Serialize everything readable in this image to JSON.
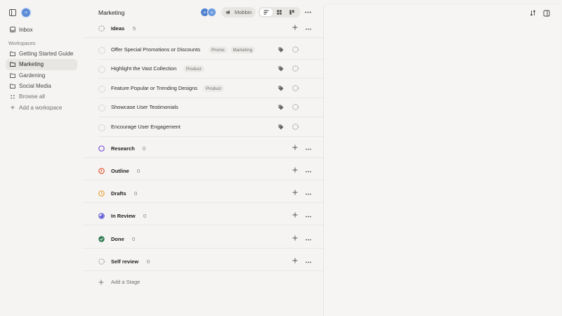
{
  "sidebar": {
    "avatar_initials": "JE",
    "inbox_label": "Inbox",
    "section_label": "Workspaces",
    "items": [
      {
        "label": "Getting Started Guide",
        "icon": "folder-icon",
        "active": false
      },
      {
        "label": "Marketing",
        "icon": "folder-icon",
        "active": true
      },
      {
        "label": "Gardening",
        "icon": "folder-icon",
        "active": false
      },
      {
        "label": "Social Media",
        "icon": "folder-icon",
        "active": false
      },
      {
        "label": "Browse all",
        "icon": "grid-icon",
        "active": false
      },
      {
        "label": "Add a workspace",
        "icon": "plus-icon",
        "active": false
      }
    ]
  },
  "header": {
    "title": "Marketing",
    "avatar1": "JE",
    "avatar2": "M",
    "pill_label": "Mobbin"
  },
  "stages": {
    "ideas": {
      "name": "Ideas",
      "count": "5"
    },
    "research": {
      "name": "Research",
      "count": "0"
    },
    "outline": {
      "name": "Outline",
      "count": "0"
    },
    "drafts": {
      "name": "Drafts",
      "count": "0"
    },
    "in_review": {
      "name": "In Review",
      "count": "0"
    },
    "done": {
      "name": "Done",
      "count": "0"
    },
    "self_review": {
      "name": "Self review",
      "count": "0"
    }
  },
  "tasks": [
    {
      "title": "Offer Special Promotions or Discounts",
      "tags": [
        "Promo",
        "Marketing"
      ]
    },
    {
      "title": "Highlight the Vast Collection",
      "tags": [
        "Product"
      ]
    },
    {
      "title": "Feature Popular or Trending Designs",
      "tags": [
        "Product"
      ]
    },
    {
      "title": "Showcase User Testimonials",
      "tags": []
    },
    {
      "title": "Encourage User Engagement",
      "tags": []
    }
  ],
  "add_stage_label": "Add a Stage",
  "colors": {
    "research": "#7b54d6",
    "outline": "#e0542e",
    "drafts": "#e8a33b",
    "in_review": "#5b55d6",
    "done": "#2f7a4f",
    "accent_avatar": "#5b8bd6"
  }
}
